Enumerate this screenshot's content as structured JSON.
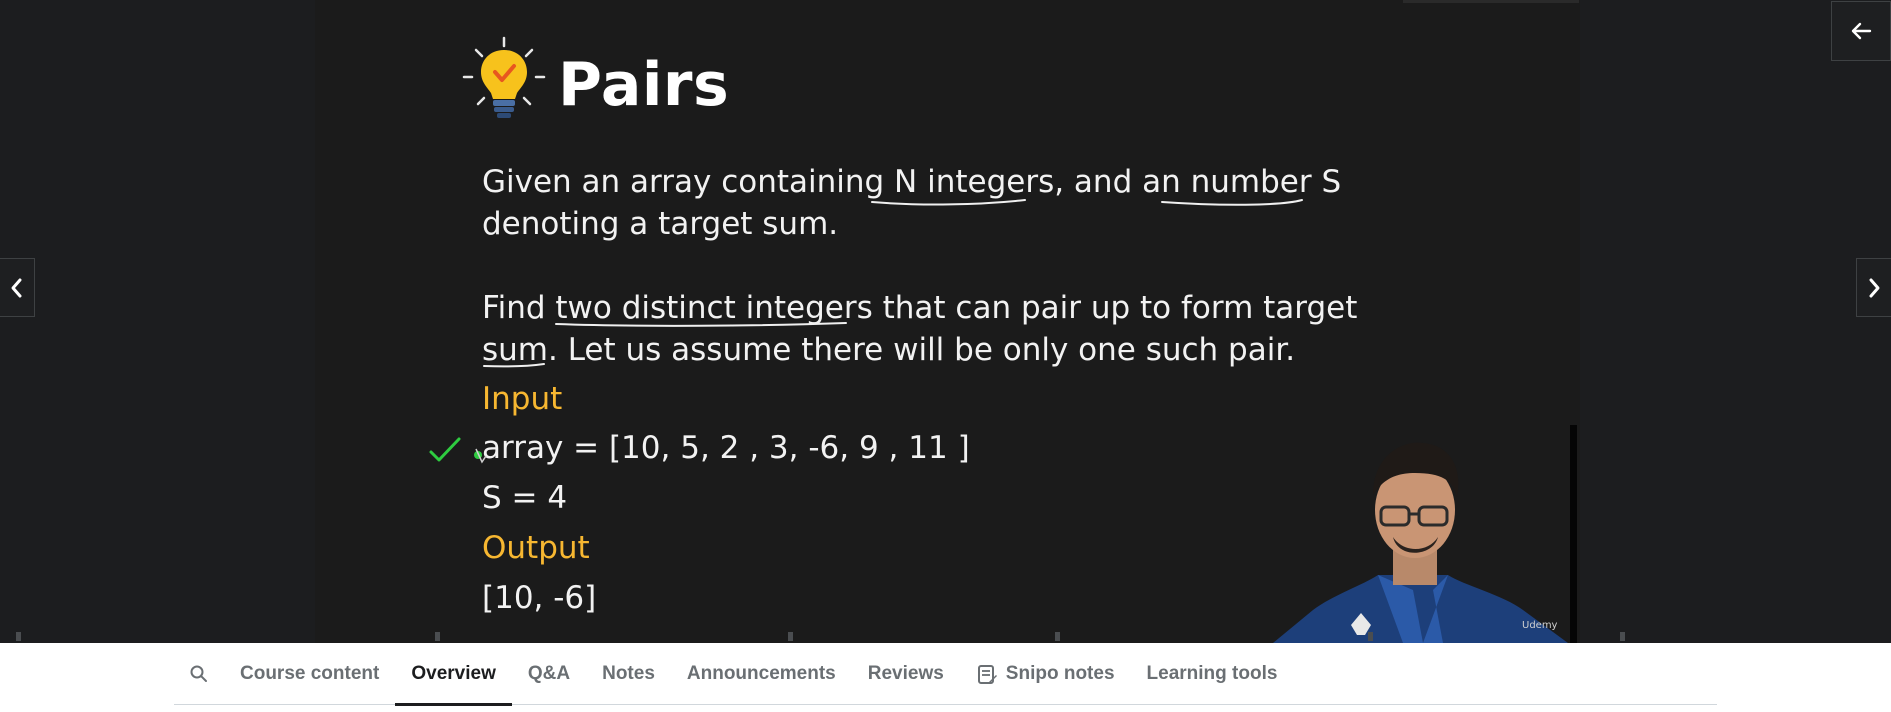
{
  "slide": {
    "title": "Pairs",
    "line1": "Given an array containing N integers, and an number S",
    "line2": "denoting a target sum.",
    "line3": "Find two distinct integers that can pair up to form target",
    "line4": "sum. Let us assume there will be only one such pair.",
    "input_label": "Input",
    "array_line": "array = [10, 5, 2 , 3, -6, 9 , 11 ]",
    "s_line": "S = 4",
    "output_label": "Output",
    "output_line": "[10, -6]"
  },
  "presenter": {
    "logo_text": "Udemy"
  },
  "tabs": {
    "course_content": "Course content",
    "overview": "Overview",
    "qa": "Q&A",
    "notes": "Notes",
    "announcements": "Announcements",
    "reviews": "Reviews",
    "snipo_notes": "Snipo notes",
    "learning_tools": "Learning tools"
  },
  "colors": {
    "slide_bg": "#1b1b1b",
    "accent_yellow": "#f7b731",
    "check_green": "#2ecc40",
    "tab_active": "#1c1d1f",
    "tab_inactive": "#6a6f73"
  },
  "icons": {
    "back": "arrow-left-icon",
    "prev": "chevron-left-icon",
    "next": "chevron-right-icon",
    "search": "search-icon",
    "snipo": "notes-icon",
    "bulb": "lightbulb-icon",
    "check": "checkmark-icon"
  }
}
